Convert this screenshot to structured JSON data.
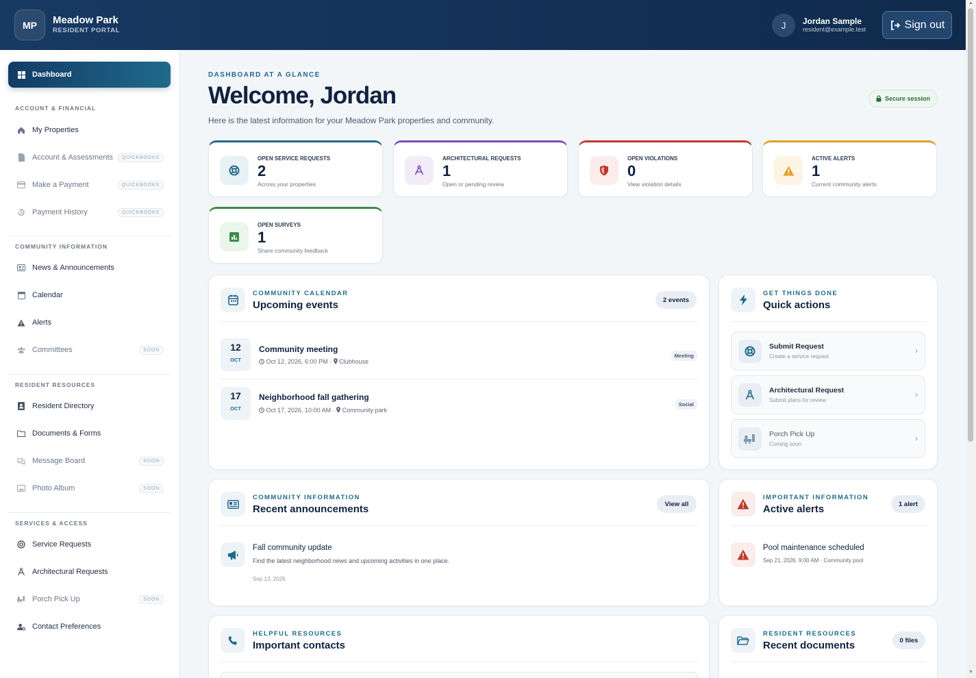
{
  "header": {
    "logo_initials": "MP",
    "brand_name": "Meadow Park",
    "brand_sub": "RESIDENT PORTAL",
    "user_initial": "J",
    "user_name": "Jordan Sample",
    "user_email": "resident@example.test",
    "signout_label": "Sign out"
  },
  "sidebar": {
    "dashboard_label": "Dashboard",
    "sections": [
      {
        "title": "ACCOUNT & FINANCIAL"
      },
      {
        "title": "COMMUNITY INFORMATION"
      },
      {
        "title": "RESIDENT RESOURCES"
      },
      {
        "title": "SERVICES & ACCESS"
      }
    ],
    "items": [
      {
        "label": "My Properties",
        "tag": "",
        "icon": "home-icon"
      },
      {
        "label": "Account & Assessments",
        "tag": "QUICKBOOKS",
        "icon": "file-icon"
      },
      {
        "label": "Make a Payment",
        "tag": "QUICKBOOKS",
        "icon": "card-icon"
      },
      {
        "label": "Payment History",
        "tag": "QUICKBOOKS",
        "icon": "history-icon"
      },
      {
        "label": "News & Announcements",
        "tag": "",
        "icon": "newspaper-icon"
      },
      {
        "label": "Calendar",
        "tag": "",
        "icon": "calendar-icon"
      },
      {
        "label": "Alerts",
        "tag": "",
        "icon": "warning-icon"
      },
      {
        "label": "Committees",
        "tag": "SOON",
        "icon": "people-icon"
      },
      {
        "label": "Resident Directory",
        "tag": "",
        "icon": "directory-icon"
      },
      {
        "label": "Documents & Forms",
        "tag": "",
        "icon": "folder-icon"
      },
      {
        "label": "Message Board",
        "tag": "SOON",
        "icon": "chat-icon"
      },
      {
        "label": "Photo Album",
        "tag": "SOON",
        "icon": "image-icon"
      },
      {
        "label": "Service Requests",
        "tag": "",
        "icon": "lifebuoy-icon"
      },
      {
        "label": "Architectural Requests",
        "tag": "",
        "icon": "compass-icon"
      },
      {
        "label": "Porch Pick Up",
        "tag": "SOON",
        "icon": "truck-icon"
      },
      {
        "label": "Contact Preferences",
        "tag": "",
        "icon": "user-gear-icon"
      }
    ]
  },
  "main": {
    "eyebrow": "DASHBOARD AT A GLANCE",
    "title": "Welcome, Jordan",
    "intro": "Here is the latest information for your Meadow Park properties and community.",
    "secure_label": "Secure session"
  },
  "stats": [
    {
      "label": "OPEN SERVICE REQUESTS",
      "value": "2",
      "sub": "Across your properties",
      "color": "#1f6a8a"
    },
    {
      "label": "ARCHITECTURAL REQUESTS",
      "value": "1",
      "sub": "Open or pending review",
      "color": "#7a4bb0"
    },
    {
      "label": "OPEN VIOLATIONS",
      "value": "0",
      "sub": "View violation details",
      "color": "#c0392b"
    },
    {
      "label": "ACTIVE ALERTS",
      "value": "1",
      "sub": "Current community alerts",
      "color": "#e0a02a"
    },
    {
      "label": "OPEN SURVEYS",
      "value": "1",
      "sub": "Share community feedback",
      "color": "#3f8a4c"
    }
  ],
  "calendar": {
    "eyebrow": "COMMUNITY CALENDAR",
    "title": "Upcoming events",
    "count": "2 events",
    "events": [
      {
        "day": "12",
        "month": "OCT",
        "title": "Community meeting",
        "datetime": "Oct 12, 2026, 6:00 PM",
        "location": "Clubhouse",
        "tag": "Meeting"
      },
      {
        "day": "17",
        "month": "OCT",
        "title": "Neighborhood fall gathering",
        "datetime": "Oct 17, 2026, 10:00 AM",
        "location": "Community park",
        "tag": "Social"
      }
    ]
  },
  "quick": {
    "eyebrow": "GET THINGS DONE",
    "title": "Quick actions",
    "actions": [
      {
        "title": "Submit Request",
        "sub": "Create a service request"
      },
      {
        "title": "Architectural Request",
        "sub": "Submit plans for review"
      },
      {
        "title": "Porch Pick Up",
        "sub": "Coming soon"
      }
    ]
  },
  "announcements": {
    "eyebrow": "COMMUNITY INFORMATION",
    "title": "Recent announcements",
    "view_all": "View all",
    "item_title": "Fall community update",
    "item_body": "Find the latest neighborhood news and upcoming activities in one place.",
    "item_date": "Sep 13, 2026"
  },
  "alerts": {
    "eyebrow": "IMPORTANT INFORMATION",
    "title": "Active alerts",
    "count": "1 alert",
    "item_title": "Pool maintenance scheduled",
    "item_meta": "Sep 21, 2026, 9:00 AM · Community pool"
  },
  "contacts": {
    "eyebrow": "HELPFUL RESOURCES",
    "title": "Important contacts"
  },
  "documents": {
    "eyebrow": "RESIDENT RESOURCES",
    "title": "Recent documents",
    "count": "0 files"
  }
}
